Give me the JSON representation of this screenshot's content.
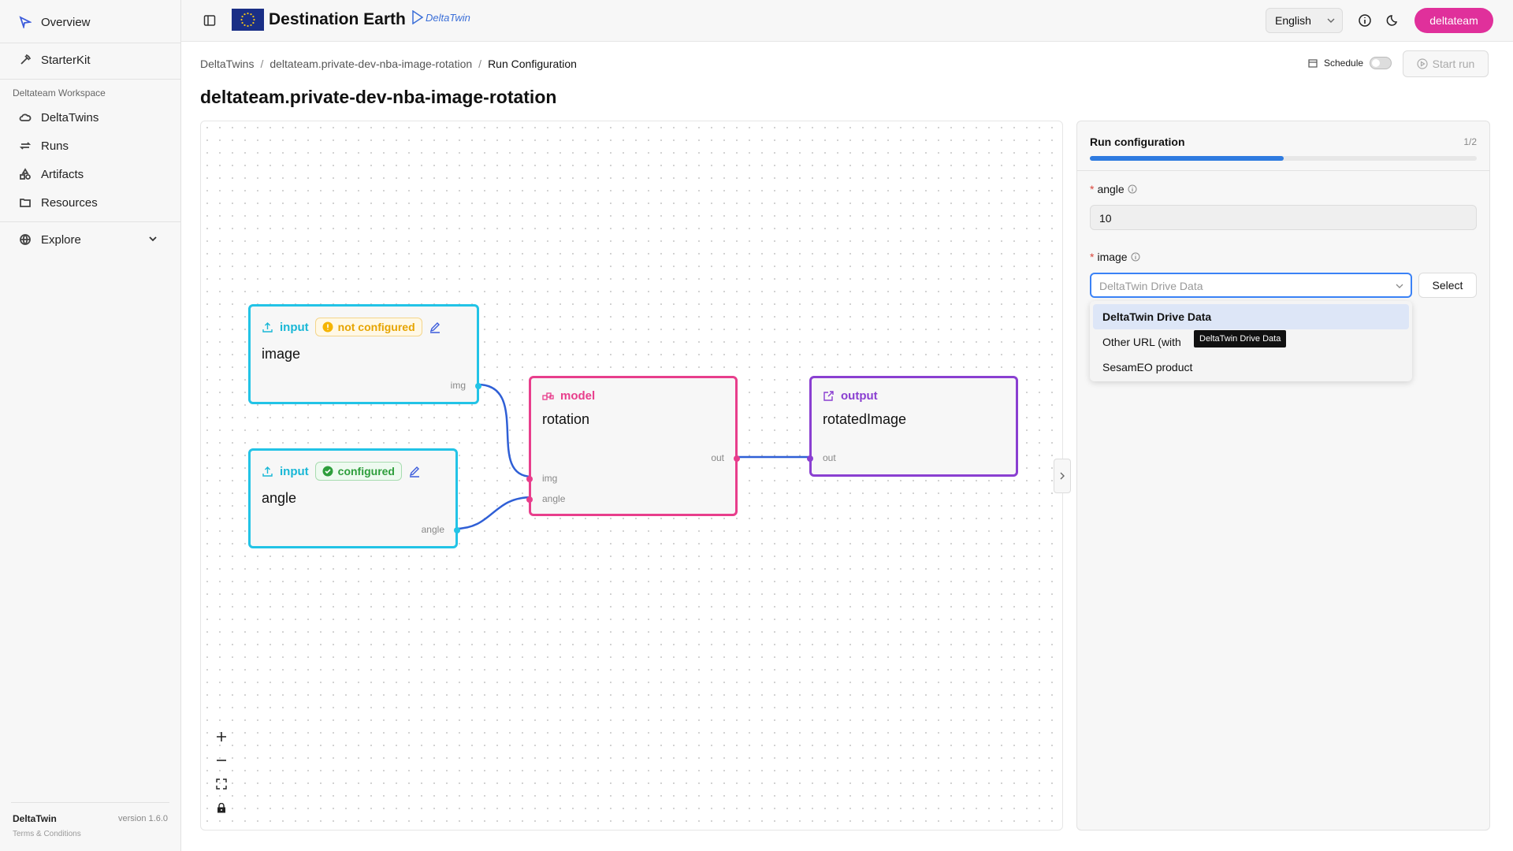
{
  "sidebar": {
    "overview": "Overview",
    "starterkit": "StarterKit",
    "workspace_label": "Deltateam Workspace",
    "items": [
      {
        "label": "DeltaTwins"
      },
      {
        "label": "Runs"
      },
      {
        "label": "Artifacts"
      },
      {
        "label": "Resources"
      }
    ],
    "explore": "Explore",
    "footer_app": "DeltaTwin",
    "footer_version": "version 1.6.0",
    "footer_terms": "Terms & Conditions"
  },
  "header": {
    "brand": "Destination Earth",
    "logo_text": "DeltaTwin",
    "language": "English",
    "user": "deltateam",
    "user_color": "#e0309b"
  },
  "breadcrumb": {
    "root": "DeltaTwins",
    "project": "deltateam.private-dev-nba-image-rotation",
    "current": "Run Configuration"
  },
  "toolbar": {
    "schedule_label": "Schedule",
    "start_run_label": "Start run"
  },
  "page": {
    "title": "deltateam.private-dev-nba-image-rotation"
  },
  "canvas": {
    "nodes": {
      "image_input": {
        "type": "input",
        "status": "not configured",
        "name": "image",
        "port_out": "img"
      },
      "angle_input": {
        "type": "input",
        "status": "configured",
        "name": "angle",
        "port_out": "angle"
      },
      "model": {
        "type": "model",
        "name": "rotation",
        "port_in_1": "img",
        "port_in_2": "angle",
        "port_out": "out"
      },
      "output": {
        "type": "output",
        "name": "rotatedImage",
        "port_in": "out"
      }
    },
    "colors": {
      "input": "#22c3e6",
      "model": "#e83e8c",
      "output": "#8a3fd1",
      "edge": "#2f5fd6"
    },
    "controls": [
      "zoom-in",
      "zoom-out",
      "fit-view",
      "lock"
    ]
  },
  "panel": {
    "title": "Run configuration",
    "step": "1/2",
    "progress": 0.5,
    "fields": {
      "angle": {
        "label": "angle",
        "value": "10"
      },
      "image": {
        "label": "image",
        "placeholder": "DeltaTwin Drive Data",
        "select_button": "Select",
        "options": [
          "DeltaTwin Drive Data",
          "Other URL (with",
          "SesamEO product"
        ],
        "tooltip": "DeltaTwin Drive Data"
      }
    }
  }
}
